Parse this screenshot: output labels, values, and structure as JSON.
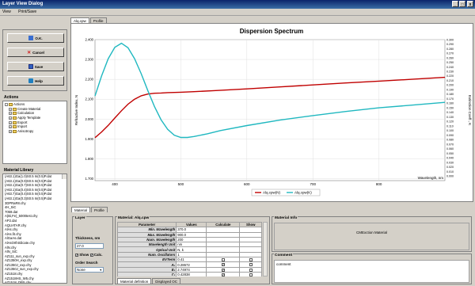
{
  "window": {
    "title": "Layer View Dialog",
    "buttons": [
      "_",
      "□",
      "x"
    ]
  },
  "menu": [
    "View",
    "Print/Save"
  ],
  "actions_buttons": [
    {
      "label": "O.K.",
      "icon": "ok-icon",
      "color": "#3a6ed0"
    },
    {
      "label": "Cancel",
      "icon": "cancel-icon",
      "color": "#d02020"
    },
    {
      "label": "Save",
      "icon": "save-icon",
      "color": "#3060c0"
    },
    {
      "label": "Help",
      "icon": "help-icon",
      "color": "#2080c0"
    }
  ],
  "actions_panel": {
    "title": "Actions",
    "root": "Actions",
    "items": [
      "Create Material",
      "Calculation",
      "Apply Template",
      "Export",
      "Import",
      "Anisotropy"
    ]
  },
  "library": {
    "title": "Material Library",
    "items": [
      "(A63.1)Ga(1.0)S0.5 In(0.5)P.dat",
      "(A63.1)Ga(0.9)S0.5 In(0.5)P.dat",
      "(A63.1)Ga(0.7)S0.5 In(0.5)P.dat",
      "(A63.1)Ga(0.4)S0.5 In(0.5)P.dat",
      "(A63.7)Ga(0.4)S0.5 In(0.5)P.dat",
      "(A63.1)Ga(0.3)S0.5 In(0.5)P.dat",
      "3DPRaR8.chy",
      "4H_SiC",
      "7059.dat",
      "A(Bi,Fe)_5000test.chy",
      "AP2.dat",
      "AQUATAR.chy",
      "AlAs.chy",
      "AlAs.fit.chy",
      "AlGaAs.dat",
      "AlAsOrthSilicate.chy",
      "AlN.chy",
      "AlN_SiC",
      "AZ111_sun_exp.chy",
      "AZ1350H_exp.chy",
      "AZ1350J_exp.chy",
      "AZ1350J_sun_exp.chy",
      "AZ1518.chy",
      "AZ1518HS_W5.chy",
      "AZ1518_DPS.chy",
      "AZ4500.chy"
    ]
  },
  "main_tabs": [
    "Alq.cpw",
    "Profile"
  ],
  "chart_data": {
    "type": "line",
    "title": "Dispersion Spectrum",
    "xlabel": "Wavelength, nm",
    "ylabel": "Refractive Index, N",
    "y2label": "Extinction Coeff., K",
    "xlim": [
      370,
      900
    ],
    "ylim": [
      1.69,
      2.4
    ],
    "y2lim": [
      -0.01,
      0.3
    ],
    "x_ticks": [
      "400",
      "500",
      "600",
      "700",
      "800"
    ],
    "y_ticks": [
      "2.400",
      "2.300",
      "2.200",
      "2.100",
      "2.000",
      "1.900",
      "1.800",
      "1.700"
    ],
    "y2_ticks": [
      "0.300",
      "0.290",
      "0.280",
      "0.270",
      "0.260",
      "0.250",
      "0.240",
      "0.230",
      "0.220",
      "0.210",
      "0.200",
      "0.190",
      "0.180",
      "0.170",
      "0.160",
      "0.150",
      "0.140",
      "0.130",
      "0.120",
      "0.110",
      "0.100",
      "0.090",
      "0.080",
      "0.070",
      "0.060",
      "0.050",
      "0.040",
      "0.030",
      "0.020",
      "0.010",
      "0.000"
    ],
    "legend_position": "bottom-center",
    "series": [
      {
        "name": "Alq.cpw(N)",
        "color": "#c00000",
        "axis": "left",
        "x": [
          370,
          380,
          390,
          400,
          410,
          420,
          430,
          440,
          450,
          460,
          470,
          480,
          490,
          500,
          520,
          550,
          600,
          650,
          700,
          750,
          800,
          850,
          900
        ],
        "y": [
          1.906,
          1.935,
          1.968,
          2.005,
          2.042,
          2.075,
          2.1,
          2.117,
          2.126,
          2.13,
          2.131,
          2.133,
          2.134,
          2.135,
          2.138,
          2.143,
          2.152,
          2.162,
          2.172,
          2.182,
          2.191,
          2.2,
          2.21
        ]
      },
      {
        "name": "Alq.cpw(K)",
        "color": "#20b8c0",
        "axis": "right",
        "x": [
          370,
          380,
          390,
          400,
          410,
          420,
          430,
          440,
          450,
          460,
          470,
          480,
          490,
          500,
          510,
          520,
          540,
          560,
          600,
          650,
          700,
          750,
          800,
          850,
          900
        ],
        "y": [
          0.176,
          0.22,
          0.258,
          0.283,
          0.292,
          0.282,
          0.258,
          0.225,
          0.188,
          0.153,
          0.124,
          0.103,
          0.09,
          0.085,
          0.085,
          0.087,
          0.093,
          0.1,
          0.111,
          0.123,
          0.133,
          0.142,
          0.15,
          0.156,
          0.162
        ]
      }
    ]
  },
  "bottom_tabs": [
    "Material",
    "Profile"
  ],
  "layer": {
    "title": "Layer",
    "thickness_label": "Thickness, nm",
    "thickness_value": "27.0",
    "show_label": "Show",
    "calc_label": "Calc.",
    "order_label": "Order Search",
    "order_value": "None"
  },
  "material_table": {
    "title": "Material: Alq.cpw",
    "headers": [
      "Parameter",
      "Values",
      "Calculate",
      "Show"
    ],
    "rows": [
      {
        "p": "Min. Wavelength",
        "v": "370.0",
        "c": false,
        "s": false,
        "cbx": false
      },
      {
        "p": "Max. Wavelength",
        "v": "900.0",
        "c": false,
        "s": false,
        "cbx": false
      },
      {
        "p": "Num. Wavelength",
        "v": "200",
        "c": false,
        "s": false,
        "cbx": false
      },
      {
        "p": "Wavelength Unit",
        "v": "nm",
        "c": false,
        "s": false,
        "cbx": false
      },
      {
        "p": "Optical Unit",
        "v": "N, k",
        "c": false,
        "s": false,
        "cbx": false
      },
      {
        "p": "Num. Oscillators",
        "v": "1",
        "c": false,
        "s": false,
        "cbx": false
      },
      {
        "p": "EVTerm",
        "v": "0.41",
        "c": false,
        "s": false,
        "cbx": true
      },
      {
        "p": "A₀",
        "v": "0.28672",
        "c": true,
        "s": false,
        "cbx": true
      },
      {
        "p": "E₀",
        "v": "2.74974",
        "c": true,
        "s": false,
        "cbx": true
      },
      {
        "p": "Γ₀",
        "v": "0.42838",
        "c": true,
        "s": false,
        "cbx": true
      },
      {
        "p": "B₀",
        "v": "-1.60002",
        "c": true,
        "s": false,
        "cbx": true
      },
      {
        "p": "D₀",
        "v": "OOGO",
        "c": false,
        "s": false,
        "cbx": false
      }
    ],
    "subtabs": [
      "Material definition",
      "Displayed OC"
    ]
  },
  "material_info": {
    "title": "Material Info",
    "text": "CMExction Material"
  },
  "comment": {
    "title": "Comment",
    "text": "comment"
  }
}
